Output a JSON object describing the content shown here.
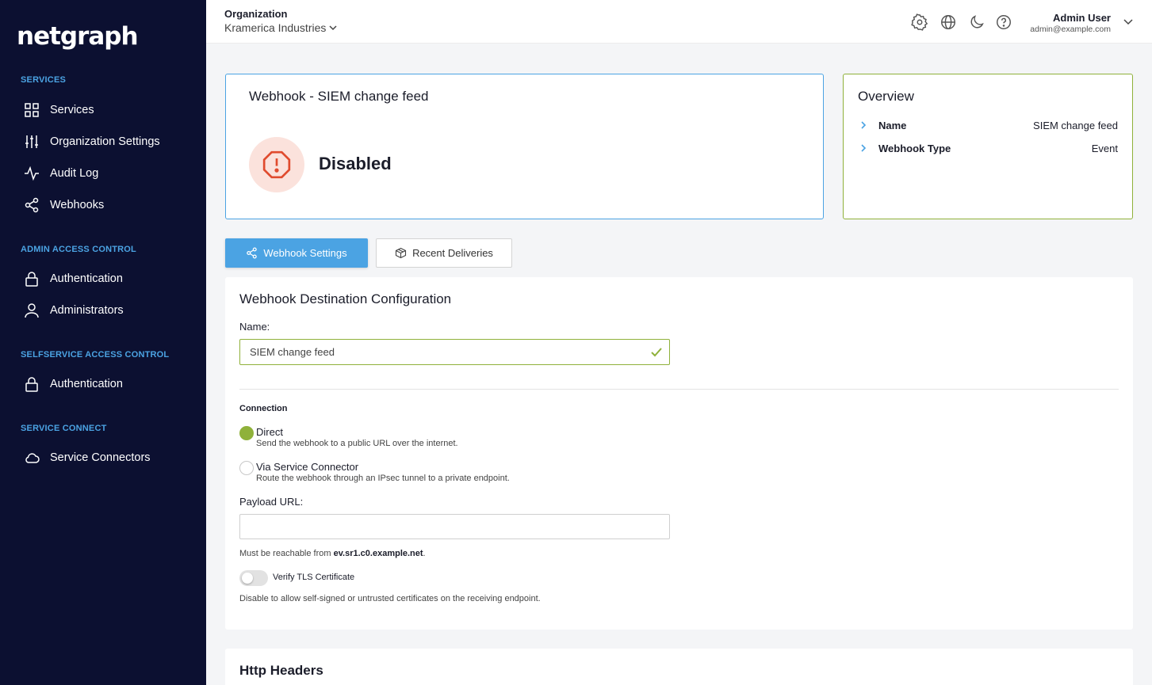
{
  "app": {
    "logo_text": "netgraph"
  },
  "sidebar": {
    "sections": [
      {
        "title": "SERVICES",
        "items": [
          {
            "label": "Services",
            "icon": "grid-icon"
          },
          {
            "label": "Organization Settings",
            "icon": "sliders-icon"
          },
          {
            "label": "Audit Log",
            "icon": "activity-icon"
          },
          {
            "label": "Webhooks",
            "icon": "share-icon"
          }
        ]
      },
      {
        "title": "ADMIN ACCESS CONTROL",
        "items": [
          {
            "label": "Authentication",
            "icon": "lock-icon"
          },
          {
            "label": "Administrators",
            "icon": "user-icon"
          }
        ]
      },
      {
        "title": "SELFSERVICE ACCESS CONTROL",
        "items": [
          {
            "label": "Authentication",
            "icon": "lock-icon"
          }
        ]
      },
      {
        "title": "SERVICE CONNECT",
        "items": [
          {
            "label": "Service Connectors",
            "icon": "cloud-icon"
          }
        ]
      }
    ]
  },
  "header": {
    "org_label": "Organization",
    "org_value": "Kramerica Industries",
    "user_name": "Admin User",
    "user_email": "admin@example.com"
  },
  "status_card": {
    "title": "Webhook - SIEM change feed",
    "status": "Disabled",
    "status_color": "#e04b2e"
  },
  "overview": {
    "title": "Overview",
    "rows": [
      {
        "key": "Name",
        "value": "SIEM change feed"
      },
      {
        "key": "Webhook Type",
        "value": "Event"
      }
    ]
  },
  "tabs": [
    {
      "label": "Webhook Settings",
      "icon": "share-icon",
      "active": true
    },
    {
      "label": "Recent Deliveries",
      "icon": "package-icon",
      "active": false
    }
  ],
  "config": {
    "title": "Webhook Destination Configuration",
    "name_label": "Name:",
    "name_value": "SIEM change feed",
    "connection_label": "Connection",
    "options": [
      {
        "title": "Direct",
        "desc": "Send the webhook to a public URL over the internet.",
        "selected": true
      },
      {
        "title": "Via Service Connector",
        "desc": "Route the webhook through an IPsec tunnel to a private endpoint.",
        "selected": false
      }
    ],
    "payload_label": "Payload URL:",
    "payload_value": "",
    "payload_hint_prefix": "Must be reachable from ",
    "payload_hint_host": "ev.sr1.c0.example.net",
    "payload_hint_suffix": ".",
    "tls_label": "Verify TLS Certificate",
    "tls_enabled": false,
    "tls_hint": "Disable to allow self-signed or untrusted certificates on the receiving endpoint."
  },
  "headers_panel": {
    "title": "Http Headers"
  },
  "colors": {
    "sidebar_bg": "#0c1031",
    "accent_blue": "#4ba3e3",
    "accent_green": "#8fb13a"
  }
}
